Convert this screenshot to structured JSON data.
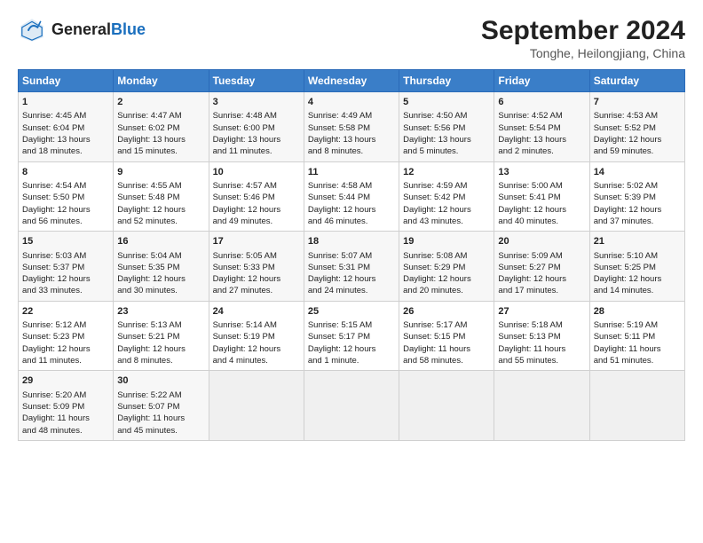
{
  "header": {
    "logo_general": "General",
    "logo_blue": "Blue",
    "main_title": "September 2024",
    "subtitle": "Tonghe, Heilongjiang, China"
  },
  "days_of_week": [
    "Sunday",
    "Monday",
    "Tuesday",
    "Wednesday",
    "Thursday",
    "Friday",
    "Saturday"
  ],
  "weeks": [
    [
      {
        "day": "1",
        "lines": [
          "Sunrise: 4:45 AM",
          "Sunset: 6:04 PM",
          "Daylight: 13 hours",
          "and 18 minutes."
        ]
      },
      {
        "day": "2",
        "lines": [
          "Sunrise: 4:47 AM",
          "Sunset: 6:02 PM",
          "Daylight: 13 hours",
          "and 15 minutes."
        ]
      },
      {
        "day": "3",
        "lines": [
          "Sunrise: 4:48 AM",
          "Sunset: 6:00 PM",
          "Daylight: 13 hours",
          "and 11 minutes."
        ]
      },
      {
        "day": "4",
        "lines": [
          "Sunrise: 4:49 AM",
          "Sunset: 5:58 PM",
          "Daylight: 13 hours",
          "and 8 minutes."
        ]
      },
      {
        "day": "5",
        "lines": [
          "Sunrise: 4:50 AM",
          "Sunset: 5:56 PM",
          "Daylight: 13 hours",
          "and 5 minutes."
        ]
      },
      {
        "day": "6",
        "lines": [
          "Sunrise: 4:52 AM",
          "Sunset: 5:54 PM",
          "Daylight: 13 hours",
          "and 2 minutes."
        ]
      },
      {
        "day": "7",
        "lines": [
          "Sunrise: 4:53 AM",
          "Sunset: 5:52 PM",
          "Daylight: 12 hours",
          "and 59 minutes."
        ]
      }
    ],
    [
      {
        "day": "8",
        "lines": [
          "Sunrise: 4:54 AM",
          "Sunset: 5:50 PM",
          "Daylight: 12 hours",
          "and 56 minutes."
        ]
      },
      {
        "day": "9",
        "lines": [
          "Sunrise: 4:55 AM",
          "Sunset: 5:48 PM",
          "Daylight: 12 hours",
          "and 52 minutes."
        ]
      },
      {
        "day": "10",
        "lines": [
          "Sunrise: 4:57 AM",
          "Sunset: 5:46 PM",
          "Daylight: 12 hours",
          "and 49 minutes."
        ]
      },
      {
        "day": "11",
        "lines": [
          "Sunrise: 4:58 AM",
          "Sunset: 5:44 PM",
          "Daylight: 12 hours",
          "and 46 minutes."
        ]
      },
      {
        "day": "12",
        "lines": [
          "Sunrise: 4:59 AM",
          "Sunset: 5:42 PM",
          "Daylight: 12 hours",
          "and 43 minutes."
        ]
      },
      {
        "day": "13",
        "lines": [
          "Sunrise: 5:00 AM",
          "Sunset: 5:41 PM",
          "Daylight: 12 hours",
          "and 40 minutes."
        ]
      },
      {
        "day": "14",
        "lines": [
          "Sunrise: 5:02 AM",
          "Sunset: 5:39 PM",
          "Daylight: 12 hours",
          "and 37 minutes."
        ]
      }
    ],
    [
      {
        "day": "15",
        "lines": [
          "Sunrise: 5:03 AM",
          "Sunset: 5:37 PM",
          "Daylight: 12 hours",
          "and 33 minutes."
        ]
      },
      {
        "day": "16",
        "lines": [
          "Sunrise: 5:04 AM",
          "Sunset: 5:35 PM",
          "Daylight: 12 hours",
          "and 30 minutes."
        ]
      },
      {
        "day": "17",
        "lines": [
          "Sunrise: 5:05 AM",
          "Sunset: 5:33 PM",
          "Daylight: 12 hours",
          "and 27 minutes."
        ]
      },
      {
        "day": "18",
        "lines": [
          "Sunrise: 5:07 AM",
          "Sunset: 5:31 PM",
          "Daylight: 12 hours",
          "and 24 minutes."
        ]
      },
      {
        "day": "19",
        "lines": [
          "Sunrise: 5:08 AM",
          "Sunset: 5:29 PM",
          "Daylight: 12 hours",
          "and 20 minutes."
        ]
      },
      {
        "day": "20",
        "lines": [
          "Sunrise: 5:09 AM",
          "Sunset: 5:27 PM",
          "Daylight: 12 hours",
          "and 17 minutes."
        ]
      },
      {
        "day": "21",
        "lines": [
          "Sunrise: 5:10 AM",
          "Sunset: 5:25 PM",
          "Daylight: 12 hours",
          "and 14 minutes."
        ]
      }
    ],
    [
      {
        "day": "22",
        "lines": [
          "Sunrise: 5:12 AM",
          "Sunset: 5:23 PM",
          "Daylight: 12 hours",
          "and 11 minutes."
        ]
      },
      {
        "day": "23",
        "lines": [
          "Sunrise: 5:13 AM",
          "Sunset: 5:21 PM",
          "Daylight: 12 hours",
          "and 8 minutes."
        ]
      },
      {
        "day": "24",
        "lines": [
          "Sunrise: 5:14 AM",
          "Sunset: 5:19 PM",
          "Daylight: 12 hours",
          "and 4 minutes."
        ]
      },
      {
        "day": "25",
        "lines": [
          "Sunrise: 5:15 AM",
          "Sunset: 5:17 PM",
          "Daylight: 12 hours",
          "and 1 minute."
        ]
      },
      {
        "day": "26",
        "lines": [
          "Sunrise: 5:17 AM",
          "Sunset: 5:15 PM",
          "Daylight: 11 hours",
          "and 58 minutes."
        ]
      },
      {
        "day": "27",
        "lines": [
          "Sunrise: 5:18 AM",
          "Sunset: 5:13 PM",
          "Daylight: 11 hours",
          "and 55 minutes."
        ]
      },
      {
        "day": "28",
        "lines": [
          "Sunrise: 5:19 AM",
          "Sunset: 5:11 PM",
          "Daylight: 11 hours",
          "and 51 minutes."
        ]
      }
    ],
    [
      {
        "day": "29",
        "lines": [
          "Sunrise: 5:20 AM",
          "Sunset: 5:09 PM",
          "Daylight: 11 hours",
          "and 48 minutes."
        ]
      },
      {
        "day": "30",
        "lines": [
          "Sunrise: 5:22 AM",
          "Sunset: 5:07 PM",
          "Daylight: 11 hours",
          "and 45 minutes."
        ]
      },
      null,
      null,
      null,
      null,
      null
    ]
  ]
}
